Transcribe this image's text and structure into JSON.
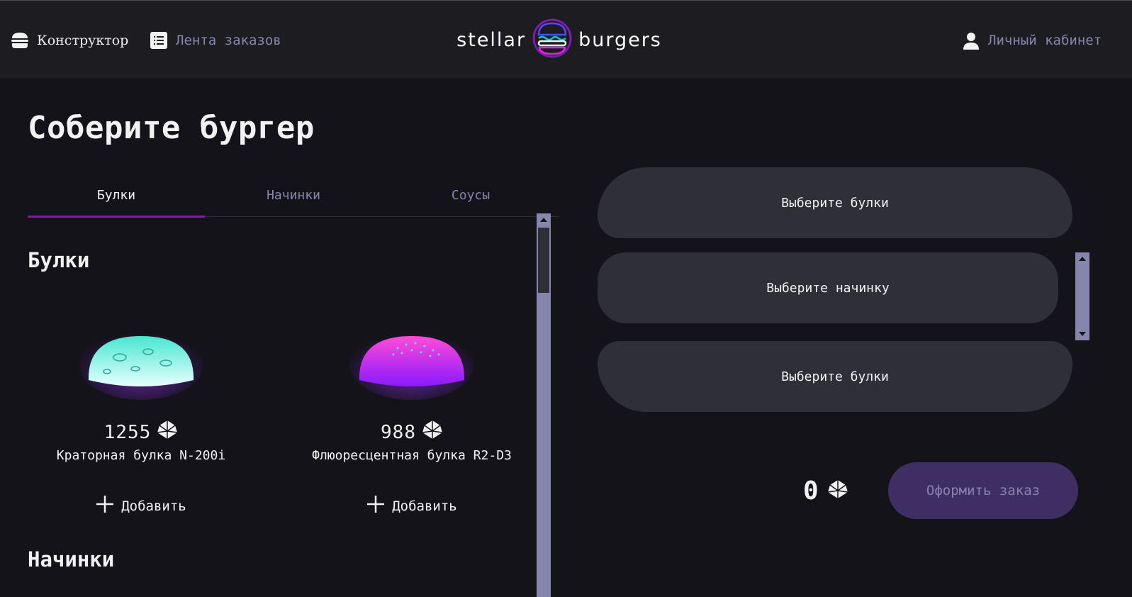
{
  "header": {
    "nav": {
      "constructor_label": "Конструктор",
      "feed_label": "Лента заказов",
      "account_label": "Личный кабинет"
    },
    "logo": {
      "left_word": "stellar",
      "right_word": "burgers"
    }
  },
  "main": {
    "title": "Соберите бургер",
    "tabs": [
      {
        "label": "Булки",
        "active": true
      },
      {
        "label": "Начинки",
        "active": false
      },
      {
        "label": "Соусы",
        "active": false
      }
    ],
    "sections": [
      {
        "title": "Булки",
        "items": [
          {
            "price": "1255",
            "name": "Краторная булка N-200i",
            "add_label": "Добавить",
            "color": "#7ff5e6"
          },
          {
            "price": "988",
            "name": "Флюоресцентная булка R2-D3",
            "add_label": "Добавить",
            "color": "#e024e8"
          }
        ]
      },
      {
        "title": "Начинки",
        "items": []
      }
    ]
  },
  "constructor": {
    "top_bun_placeholder": "Выберите булки",
    "filling_placeholder": "Выберите начинку",
    "bottom_bun_placeholder": "Выберите булки",
    "total": "0",
    "order_button": "Оформить заказ"
  },
  "icons": {
    "constructor": "burger-icon",
    "feed": "list-icon",
    "account": "profile-icon",
    "currency": "currency-icon",
    "add": "plus-icon"
  },
  "colors": {
    "background": "#131319",
    "header": "#1c1c21",
    "accent": "#801ab3",
    "inactive_text": "#8585ad",
    "slot": "#2f2f37",
    "order_button_disabled": "#3f2e63"
  }
}
